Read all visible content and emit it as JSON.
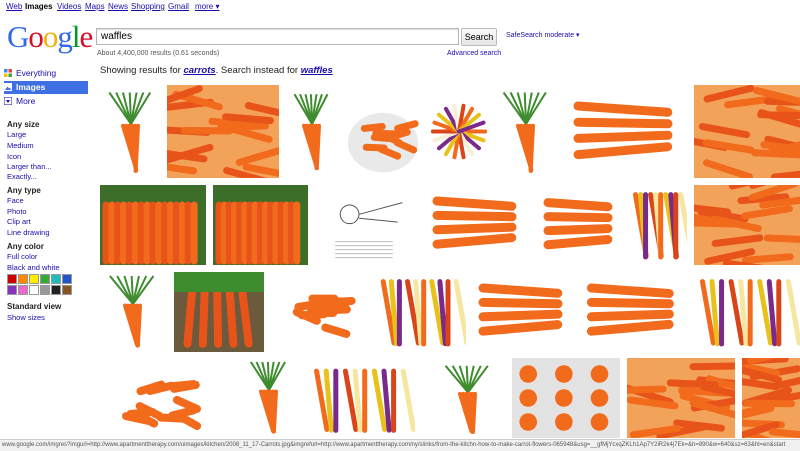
{
  "topbar": {
    "links": [
      "Web",
      "Images",
      "Videos",
      "Maps",
      "News",
      "Shopping",
      "Gmail",
      "more ▾"
    ]
  },
  "logo": {
    "text": "Google"
  },
  "search": {
    "query": "waffles",
    "button_label": "Search",
    "safesearch": "SafeSearch moderate ▾",
    "results_count": "About 4,400,000 results (0.61 seconds)",
    "advanced_search": "Advanced search"
  },
  "showing": {
    "prefix": "Showing results for ",
    "corrected": "carrots",
    "middle": ". Search instead for ",
    "original": "waffles"
  },
  "sidebar": {
    "nav": [
      "Everything",
      "Images",
      "More"
    ],
    "size_heading": "Any size",
    "sizes": [
      "Large",
      "Medium",
      "Icon",
      "Larger than...",
      "Exactly..."
    ],
    "type_heading": "Any type",
    "types": [
      "Face",
      "Photo",
      "Clip art",
      "Line drawing"
    ],
    "color_heading": "Any color",
    "colors": [
      "Full color",
      "Black and white"
    ],
    "swatches": [
      "#cc0000",
      "#ff8800",
      "#ffee00",
      "#33aa33",
      "#22bbbb",
      "#2255cc",
      "#8833bb",
      "#ee66cc",
      "#ffffff",
      "#999999",
      "#222222",
      "#885522"
    ],
    "view_heading": "Standard view",
    "view_link": "Show sizes"
  },
  "status_url": "www.google.com/imgres?imgurl=http://www.apartmenttherapy.com/uimages/kitchen/2008_11_17-Carrots.jpg&imgrefurl=http://www.apartmenttherapy.com/ny/slinks/from-the-kitchn-how-to-make-carrot-flowers-065948&usg=__gfMjYcxqZKLh1Ap7Y2iR2k4j7Ek=&h=890&w=640&sz=63&hl=en&start"
}
